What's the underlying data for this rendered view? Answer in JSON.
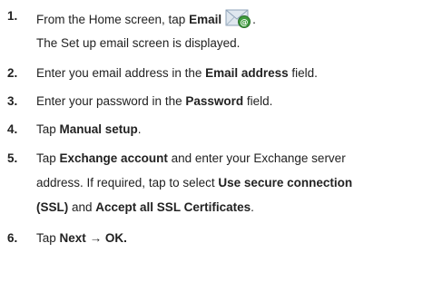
{
  "steps": [
    {
      "number": "1.",
      "prefix": "From the Home screen, tap ",
      "bold": "Email",
      "icon": "email-app-icon",
      "note": "The Set up email screen is displayed."
    },
    {
      "number": "2.",
      "prefix": "Enter you email address in the ",
      "bold": "Email address",
      "suffix": " field."
    },
    {
      "number": "3.",
      "prefix": "Enter your password in the ",
      "bold": "Password",
      "suffix": " field."
    },
    {
      "number": "4.",
      "prefix": "Tap ",
      "bold": "Manual setup",
      "suffix": "."
    },
    {
      "number": "5.",
      "prefix": "Tap ",
      "bold": "Exchange account",
      "line1_rest": " and enter your Exchange server",
      "line2_prefix": "address. If required, tap to select ",
      "line2_bold": "Use secure connection",
      "line3_bold": "(SSL)",
      "line3_mid": " and ",
      "line3_bold2": "Accept all SSL Certificates",
      "line3_end": "."
    },
    {
      "number": "6.",
      "prefix": "Tap ",
      "bold_next": "Next",
      "arrow": "→",
      "bold_ok": "OK."
    }
  ],
  "icon_colors": {
    "envelope": "#b9c7d6",
    "badge": "#3d9a3d"
  }
}
